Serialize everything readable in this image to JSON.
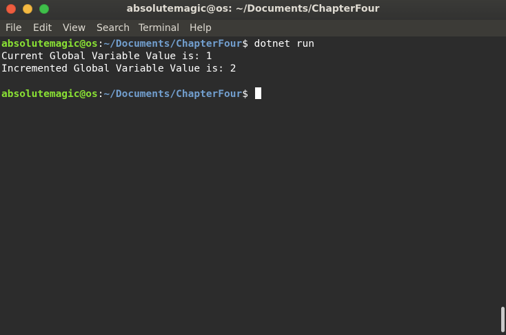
{
  "window": {
    "title": "absolutemagic@os: ~/Documents/ChapterFour"
  },
  "menu": {
    "items": [
      "File",
      "Edit",
      "View",
      "Search",
      "Terminal",
      "Help"
    ]
  },
  "terminal": {
    "prompt_user": "absolutemagic@os",
    "prompt_sep": ":",
    "prompt_path": "~/Documents/ChapterFour",
    "prompt_symbol": "$",
    "command": " dotnet run",
    "output": [
      "Current Global Variable Value is: 1",
      "Incremented Global Variable Value is: 2"
    ]
  },
  "colors": {
    "user": "#8ae234",
    "path": "#729fcf",
    "background": "#2c2c2c"
  }
}
